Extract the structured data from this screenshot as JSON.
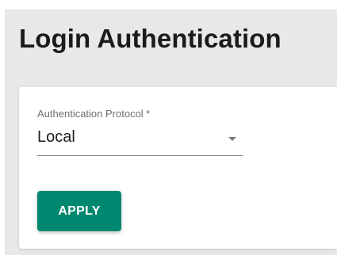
{
  "page": {
    "title": "Login Authentication"
  },
  "form": {
    "protocol_label": "Authentication Protocol *",
    "protocol_value": "Local"
  },
  "actions": {
    "apply_label": "APPLY"
  },
  "colors": {
    "primary": "#00876f",
    "background": "#e8e8e8"
  }
}
